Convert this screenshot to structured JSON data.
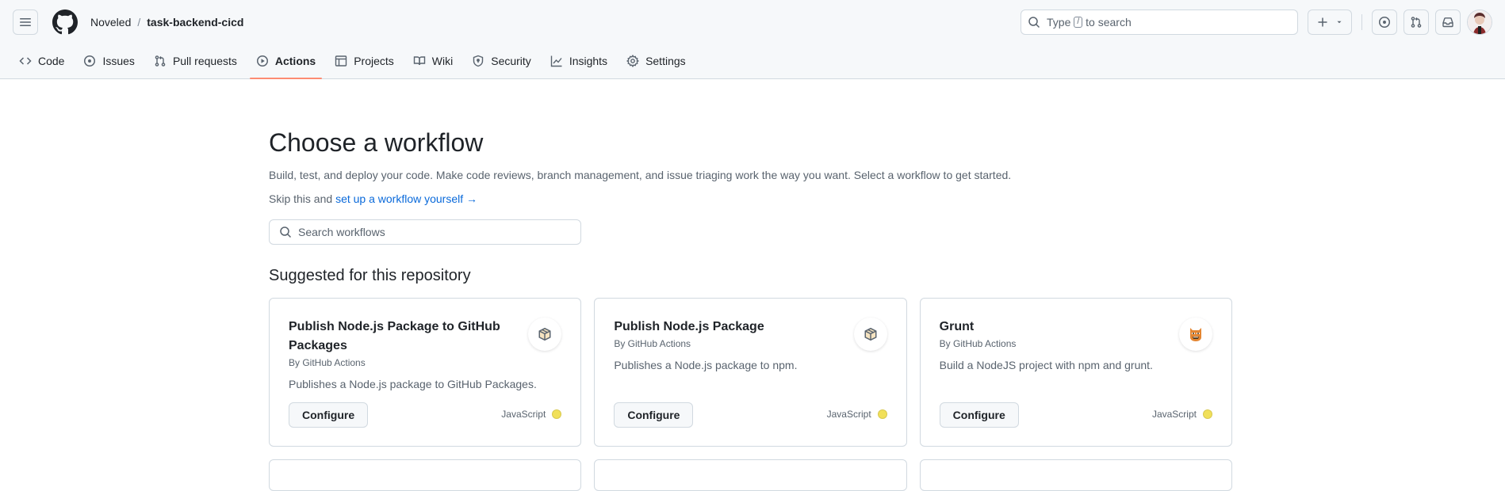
{
  "header": {
    "owner": "Noveled",
    "separator": "/",
    "repo": "task-backend-cicd",
    "search": {
      "before": "Type",
      "key": "/",
      "after": "to search"
    }
  },
  "nav": [
    {
      "label": "Code",
      "icon": "code-icon"
    },
    {
      "label": "Issues",
      "icon": "issue-opened-icon"
    },
    {
      "label": "Pull requests",
      "icon": "git-pull-request-icon"
    },
    {
      "label": "Actions",
      "icon": "play-icon",
      "active": true
    },
    {
      "label": "Projects",
      "icon": "table-icon"
    },
    {
      "label": "Wiki",
      "icon": "book-icon"
    },
    {
      "label": "Security",
      "icon": "shield-icon"
    },
    {
      "label": "Insights",
      "icon": "graph-icon"
    },
    {
      "label": "Settings",
      "icon": "gear-icon"
    }
  ],
  "main": {
    "title": "Choose a workflow",
    "description": "Build, test, and deploy your code. Make code reviews, branch management, and issue triaging work the way you want. Select a workflow to get started.",
    "skip_prefix": "Skip this and",
    "skip_link": "set up a workflow yourself",
    "skip_arrow": "→",
    "search_placeholder": "Search workflows",
    "section_title": "Suggested for this repository"
  },
  "cards": [
    {
      "title": "Publish Node.js Package to GitHub Packages",
      "by": "By GitHub Actions",
      "description": "Publishes a Node.js package to GitHub Packages.",
      "button": "Configure",
      "language": "JavaScript",
      "icon": "package-icon"
    },
    {
      "title": "Publish Node.js Package",
      "by": "By GitHub Actions",
      "description": "Publishes a Node.js package to npm.",
      "button": "Configure",
      "language": "JavaScript",
      "icon": "package-icon"
    },
    {
      "title": "Grunt",
      "by": "By GitHub Actions",
      "description": "Build a NodeJS project with npm and grunt.",
      "button": "Configure",
      "language": "JavaScript",
      "icon": "grunt-logo-icon"
    }
  ],
  "colors": {
    "javascript": "#f1e05a",
    "accent": "#fd8c73",
    "link": "#0969da"
  }
}
